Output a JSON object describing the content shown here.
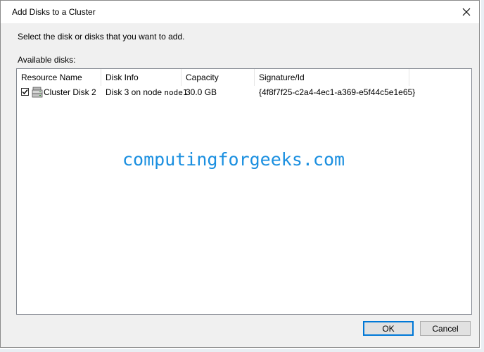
{
  "window": {
    "title": "Add Disks to a Cluster",
    "close_icon": "close-icon"
  },
  "dialog": {
    "instruction": "Select the disk or disks that you want to add.",
    "available_label": "Available disks:"
  },
  "table": {
    "columns": [
      "Resource Name",
      "Disk Info",
      "Capacity",
      "Signature/Id"
    ],
    "rows": [
      {
        "checked": true,
        "icon": "cluster-disk-icon",
        "name": "Cluster Disk 2",
        "disk_info_prefix": "Disk 3 on node",
        "disk_info_node": "node1",
        "capacity": "30.0 GB",
        "signature": "{4f8f7f25-c2a4-4ec1-a369-e5f44c5e1e65}"
      }
    ]
  },
  "watermark": "computingforgeeks.com",
  "buttons": {
    "ok": "OK",
    "cancel": "Cancel"
  },
  "colors": {
    "accent": "#0078d7",
    "watermark": "#1a8fe0",
    "dialog_bg": "#f0f0f0"
  }
}
